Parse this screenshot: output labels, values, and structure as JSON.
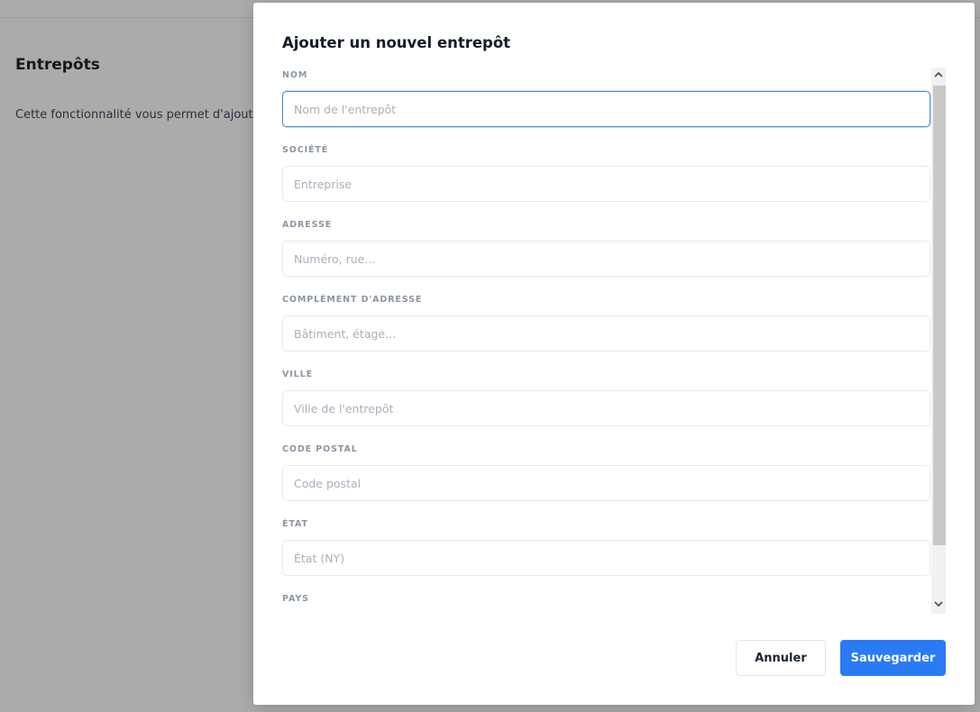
{
  "page": {
    "title": "Entrepôts",
    "description": "Cette fonctionnalité vous permet d'ajouter"
  },
  "modal": {
    "title": "Ajouter un nouvel entrepôt",
    "fields": [
      {
        "label": "NOM",
        "placeholder": "Nom de l'entrepôt",
        "value": ""
      },
      {
        "label": "SOCIÉTÉ",
        "placeholder": "Entreprise",
        "value": ""
      },
      {
        "label": "ADRESSE",
        "placeholder": "Numéro, rue...",
        "value": ""
      },
      {
        "label": "COMPLÉMENT D'ADRESSE",
        "placeholder": "Bâtiment, étage...",
        "value": ""
      },
      {
        "label": "VILLE",
        "placeholder": "Ville de l'entrepôt",
        "value": ""
      },
      {
        "label": "CODE POSTAL",
        "placeholder": "Code postal",
        "value": ""
      },
      {
        "label": "ÉTAT",
        "placeholder": "État (NY)",
        "value": ""
      },
      {
        "label": "PAYS",
        "placeholder": "",
        "value": ""
      }
    ],
    "buttons": {
      "cancel": "Annuler",
      "save": "Sauvegarder"
    }
  },
  "colors": {
    "primary": "#2a7af6",
    "focus_border": "#4b8ec9",
    "label": "#8b96a5"
  },
  "icons": {
    "scroll_up": "chevron-up-icon",
    "scroll_down": "chevron-down-icon"
  }
}
